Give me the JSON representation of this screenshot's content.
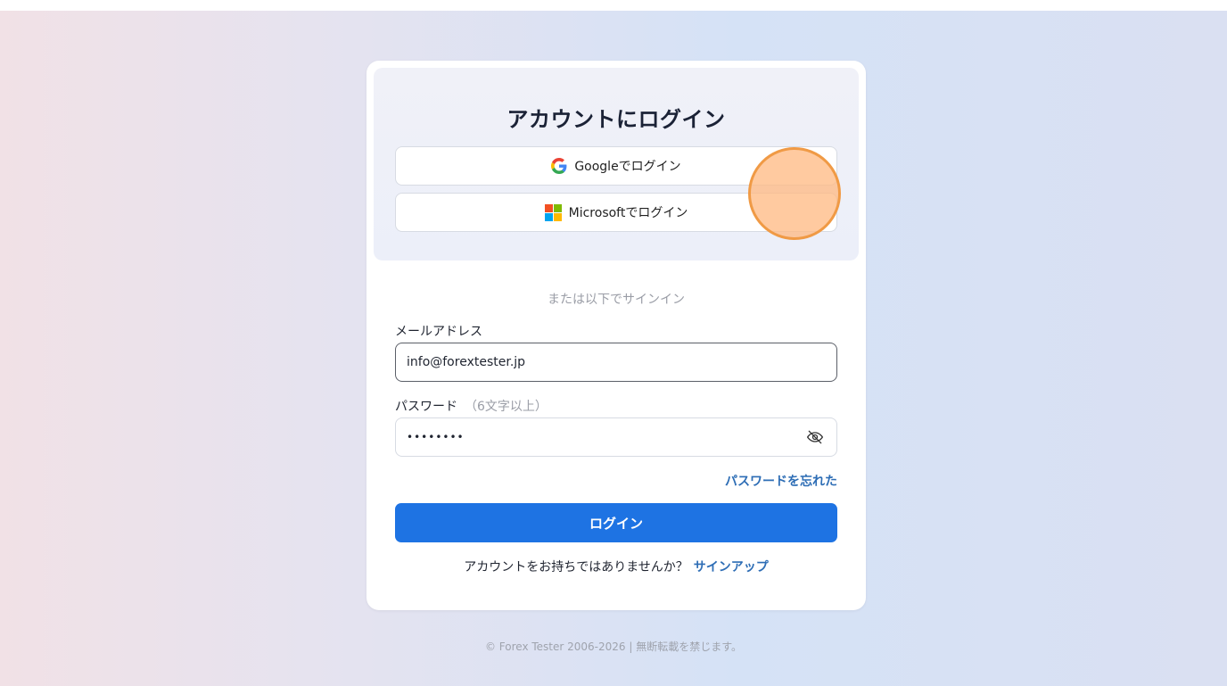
{
  "login": {
    "title": "アカウントにログイン",
    "google_label": "Googleでログイン",
    "microsoft_label": "Microsoftでログイン",
    "or_text": "または以下でサインイン",
    "email_label": "メールアドレス",
    "email_value": "info@forextester.jp",
    "password_label": "パスワード",
    "password_hint": "（6文字以上）",
    "password_value": "••••••••",
    "forgot_label": "パスワードを忘れた",
    "login_button": "ログイン",
    "no_account_text": "アカウントをお持ちではありませんか？",
    "signup_link": "サインアップ"
  },
  "footer": {
    "copyright": "© Forex Tester 2006-2026 | 無断転載を禁じます。"
  },
  "icons": {
    "google": "google-icon",
    "microsoft": "microsoft-icon",
    "eye": "eye-off-icon"
  },
  "colors": {
    "primary": "#1e73e3",
    "link": "#2d6db5",
    "cursor_highlight": "#f09a45"
  }
}
